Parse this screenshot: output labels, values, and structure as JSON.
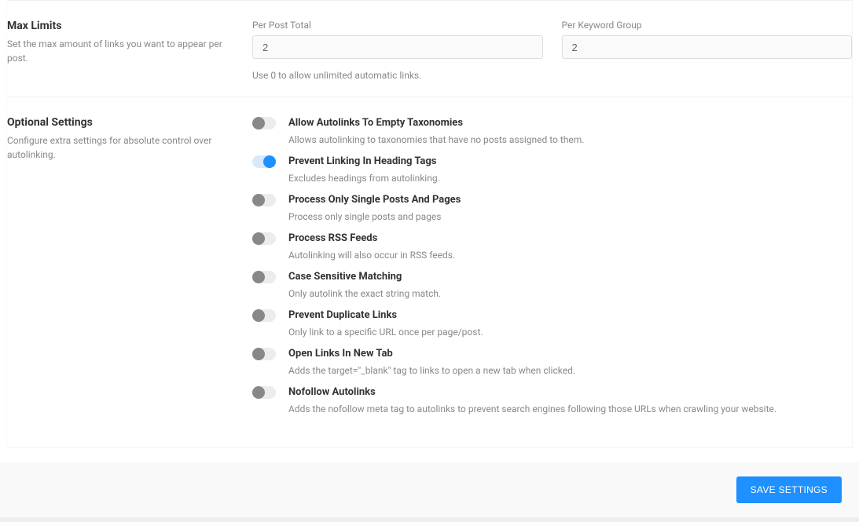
{
  "max_limits": {
    "title": "Max Limits",
    "desc": "Set the max amount of links you want to appear per post.",
    "per_post_label": "Per Post Total",
    "per_post_value": "2",
    "per_keyword_label": "Per Keyword Group",
    "per_keyword_value": "2",
    "helper": "Use 0 to allow unlimited automatic links."
  },
  "optional": {
    "title": "Optional Settings",
    "desc": "Configure extra settings for absolute control over autolinking.",
    "items": [
      {
        "label": "Allow Autolinks To Empty Taxonomies",
        "desc": "Allows autolinking to taxonomies that have no posts assigned to them.",
        "on": false
      },
      {
        "label": "Prevent Linking In Heading Tags",
        "desc": "Excludes headings from autolinking.",
        "on": true
      },
      {
        "label": "Process Only Single Posts And Pages",
        "desc": "Process only single posts and pages",
        "on": false
      },
      {
        "label": "Process RSS Feeds",
        "desc": "Autolinking will also occur in RSS feeds.",
        "on": false
      },
      {
        "label": "Case Sensitive Matching",
        "desc": "Only autolink the exact string match.",
        "on": false
      },
      {
        "label": "Prevent Duplicate Links",
        "desc": "Only link to a specific URL once per page/post.",
        "on": false
      },
      {
        "label": "Open Links In New Tab",
        "desc": "Adds the target=\"_blank\" tag to links to open a new tab when clicked.",
        "on": false
      },
      {
        "label": "Nofollow Autolinks",
        "desc": "Adds the nofollow meta tag to autolinks to prevent search engines following those URLs when crawling your website.",
        "on": false
      }
    ]
  },
  "footer": {
    "save_label": "SAVE SETTINGS"
  }
}
